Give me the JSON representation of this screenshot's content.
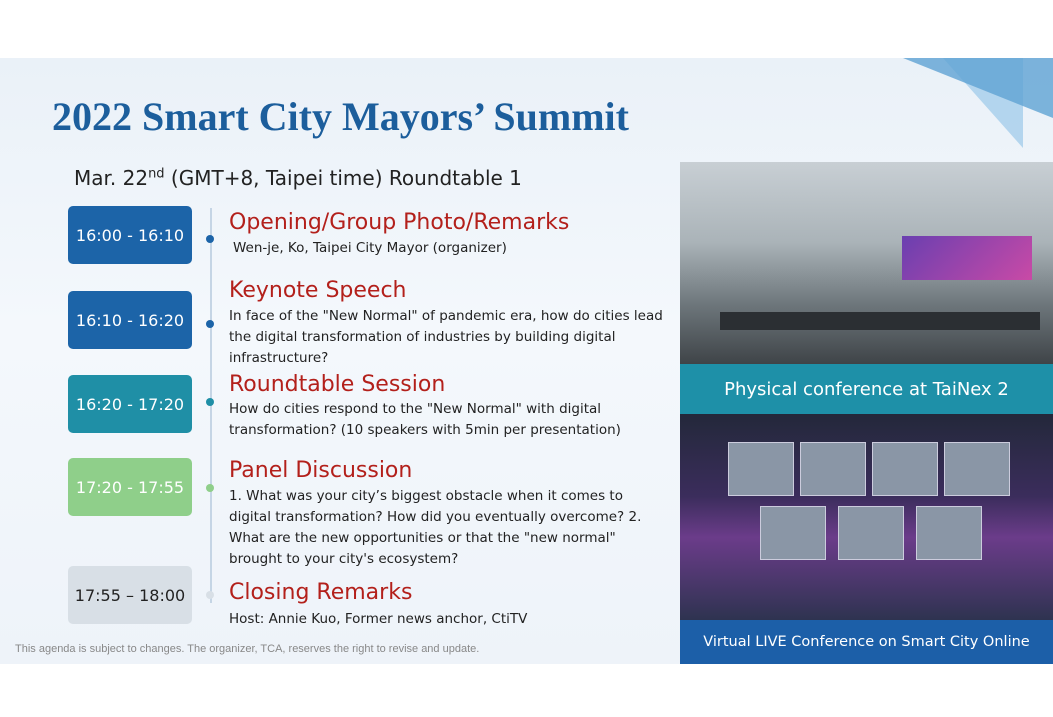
{
  "title": "2022 Smart City Mayors’ Summit",
  "date": {
    "prefix": "Mar. 22",
    "sup": "nd",
    "suffix": " (GMT+8, Taipei time) Roundtable 1"
  },
  "sessions": [
    {
      "time": "16:00 - 16:10",
      "title": "Opening/Group Photo/Remarks",
      "desc": "Wen-je, Ko, Taipei City Mayor (organizer)",
      "color": "#1c64a8"
    },
    {
      "time": "16:10 - 16:20",
      "title": "Keynote Speech",
      "desc": "In face of the \"New Normal\" of pandemic era, how do cities lead the digital transformation of industries by building digital infrastructure?",
      "color": "#1c64a8"
    },
    {
      "time": "16:20 - 17:20",
      "title": "Roundtable Session",
      "desc": "How do cities respond to the \"New Normal\" with digital transformation? (10 speakers with 5min per presentation)",
      "color": "#1f8fa6"
    },
    {
      "time": "17:20 - 17:55",
      "title": "Panel Discussion",
      "desc": "1. What was your city’s biggest obstacle when it comes to digital transformation? How did you eventually overcome? 2. What are the new opportunities or that the \"new normal\" brought to your city's ecosystem?",
      "color": "#8fcf8a"
    },
    {
      "time": "17:55 – 18:00",
      "title": "Closing Remarks",
      "desc": "Host: Annie Kuo, Former news anchor, CtiTV",
      "color": "#d8dfe6"
    }
  ],
  "note": "This agenda is subject to changes. The organizer, TCA, reserves the right to revise and update.",
  "photos": {
    "physical_caption": "Physical conference at TaiNex 2",
    "virtual_caption": "Virtual LIVE Conference on Smart City Online"
  }
}
